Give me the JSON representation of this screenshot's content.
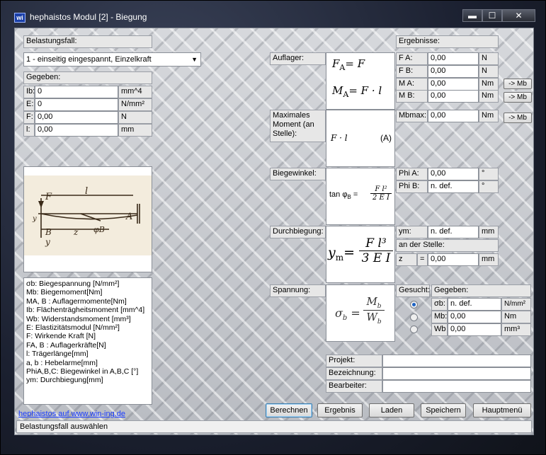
{
  "window": {
    "title": "hephaistos Modul [2] - Biegung",
    "icon_label": "wi",
    "min": "▬",
    "max": "☐",
    "close": "✕"
  },
  "left": {
    "belastungsfall_label": "Belastungsfall:",
    "belastungsfall_value": "1 - einseitig eingespannt, Einzelkraft",
    "gegeben_label": "Gegeben:",
    "inputs": [
      {
        "label": "Ib:",
        "value": "0",
        "unit": "mm^4"
      },
      {
        "label": "E:",
        "value": "0",
        "unit": "N/mm²"
      },
      {
        "label": "F:",
        "value": "0,00",
        "unit": "N"
      },
      {
        "label": "l:",
        "value": "0,00",
        "unit": "mm"
      }
    ],
    "diagram": {
      "F": "F",
      "l": "l",
      "A": "A",
      "B": "B",
      "z": "z",
      "y": "y",
      "yB": "y",
      "phiB": "φB"
    },
    "legend": [
      "σb: Biegespannung [N/mm²]",
      "Mb: Biegemoment[Nm]",
      "MA, B : Auflagermomente[Nm]",
      "Ib: Flächenträgheitsmoment [mm^4]",
      "Wb: Widerstandsmoment [mm³]",
      "E: Elastizitätsmodul [N/mm²]",
      "F: Wirkende Kraft [N]",
      "FA, B : Auflagerkräfte[N]",
      "l: Trägerlänge[mm]",
      "a, b : Hebelarme[mm]",
      "PhiA,B,C: Biegewinkel in A,B,C [°]",
      "ym: Durchbiegung[mm]"
    ],
    "link": "hephaistos auf www.win-ing.de"
  },
  "auflager": {
    "label": "Auflager:",
    "f1_lhs": "F",
    "f1_sub": "A",
    "f1_rhs": "= F",
    "f2_lhs": "M",
    "f2_sub": "A",
    "f2_rhs": "= F · l"
  },
  "ergebnisse": {
    "label": "Ergebnisse:",
    "rows": [
      {
        "label": "F A:",
        "value": "0,00",
        "unit": "N"
      },
      {
        "label": "F B:",
        "value": "0,00",
        "unit": "N"
      },
      {
        "label": "M A:",
        "value": "0,00",
        "unit": "Nm"
      },
      {
        "label": "M B:",
        "value": "0,00",
        "unit": "Nm"
      }
    ],
    "mb_buttons": [
      "-> Mb",
      "-> Mb",
      "-> Mb"
    ]
  },
  "maxmoment": {
    "label": "Maximales Moment (an Stelle):",
    "formula": "F · l",
    "stelle": "(A)",
    "mbmax_label": "Mbmax:",
    "mbmax_value": "0,00",
    "mbmax_unit": "Nm"
  },
  "biegewinkel": {
    "label": "Biegewinkel:",
    "formula_lhs": "tan φ",
    "formula_sub": "B",
    "formula_eq": " = ",
    "num": "F l²",
    "den": "2 E I",
    "rows": [
      {
        "label": "Phi A:",
        "value": "0,00",
        "unit": "°"
      },
      {
        "label": "Phi B:",
        "value": "n. def.",
        "unit": "°"
      }
    ]
  },
  "durchbiegung": {
    "label": "Durchbiegung:",
    "lhs": "y",
    "sub": "m",
    "eq": "=",
    "num": "F l³",
    "den": "3 E I",
    "ym_label": "ym:",
    "ym_value": "n. def.",
    "ym_unit": "mm",
    "stelle_label": "an der Stelle:",
    "z_label": "z",
    "z_eq": "=",
    "z_value": "0,00",
    "z_unit": "mm"
  },
  "spannung": {
    "label": "Spannung:",
    "lhs": "σ",
    "lhs_sub": "b",
    "eq": "=",
    "num": "M",
    "num_sub": "b",
    "den": "W",
    "den_sub": "b",
    "gesucht_label": "Gesucht:",
    "gegeben_label": "Gegeben:",
    "rows": [
      {
        "label": "σb:",
        "value": "n. def.",
        "unit": "N/mm²",
        "selected": true
      },
      {
        "label": "Mb:",
        "value": "0,00",
        "unit": "Nm",
        "selected": false
      },
      {
        "label": "Wb",
        "value": "0,00",
        "unit": "mm³",
        "selected": false
      }
    ]
  },
  "project": {
    "projekt": "Projekt:",
    "bezeichnung": "Bezeichnung:",
    "bearbeiter": "Bearbeiter:",
    "projekt_value": "",
    "bezeichnung_value": "",
    "bearbeiter_value": ""
  },
  "buttons": {
    "berechnen": "Berechnen",
    "ergebnis": "Ergebnis",
    "laden": "Laden",
    "speichern": "Speichern",
    "hauptmenue": "Hauptmenü"
  },
  "status": "Belastungsfall auswählen"
}
